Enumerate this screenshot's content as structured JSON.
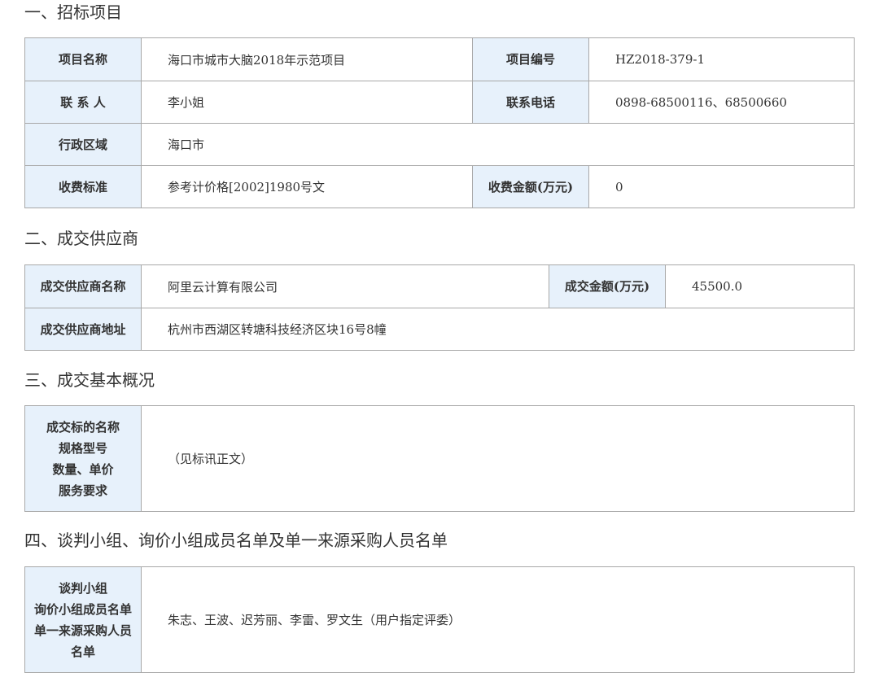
{
  "sections": {
    "s1": {
      "title": "一、招标项目",
      "project_name_label": "项目名称",
      "project_name": "海口市城市大脑2018年示范项目",
      "project_no_label": "项目编号",
      "project_no": "HZ2018-379-1",
      "contact_label": "联 系 人",
      "contact": "李小姐",
      "phone_label": "联系电话",
      "phone": "0898-68500116、68500660",
      "region_label": "行政区域",
      "region": "海口市",
      "fee_std_label": "收费标准",
      "fee_std": "参考计价格[2002]1980号文",
      "fee_amount_label": "收费金额(万元)",
      "fee_amount": "0"
    },
    "s2": {
      "title": "二、成交供应商",
      "supplier_name_label": "成交供应商名称",
      "supplier_name": "阿里云计算有限公司",
      "deal_amount_label": "成交金额(万元)",
      "deal_amount": "45500.0",
      "supplier_addr_label": "成交供应商地址",
      "supplier_addr": "杭州市西湖区转塘科技经济区块16号8幢"
    },
    "s3": {
      "title": "三、成交基本概况",
      "label_lines": [
        "成交标的名称",
        "规格型号",
        "数量、单价",
        "服务要求"
      ],
      "value": "（见标讯正文）"
    },
    "s4": {
      "title": "四、谈判小组、询价小组成员名单及单一来源采购人员名单",
      "label_lines": [
        "谈判小组",
        "询价小组成员名单",
        "单一来源采购人员",
        "名单"
      ],
      "value": "朱志、王波、迟芳丽、李雷、罗文生（用户指定评委）"
    }
  }
}
